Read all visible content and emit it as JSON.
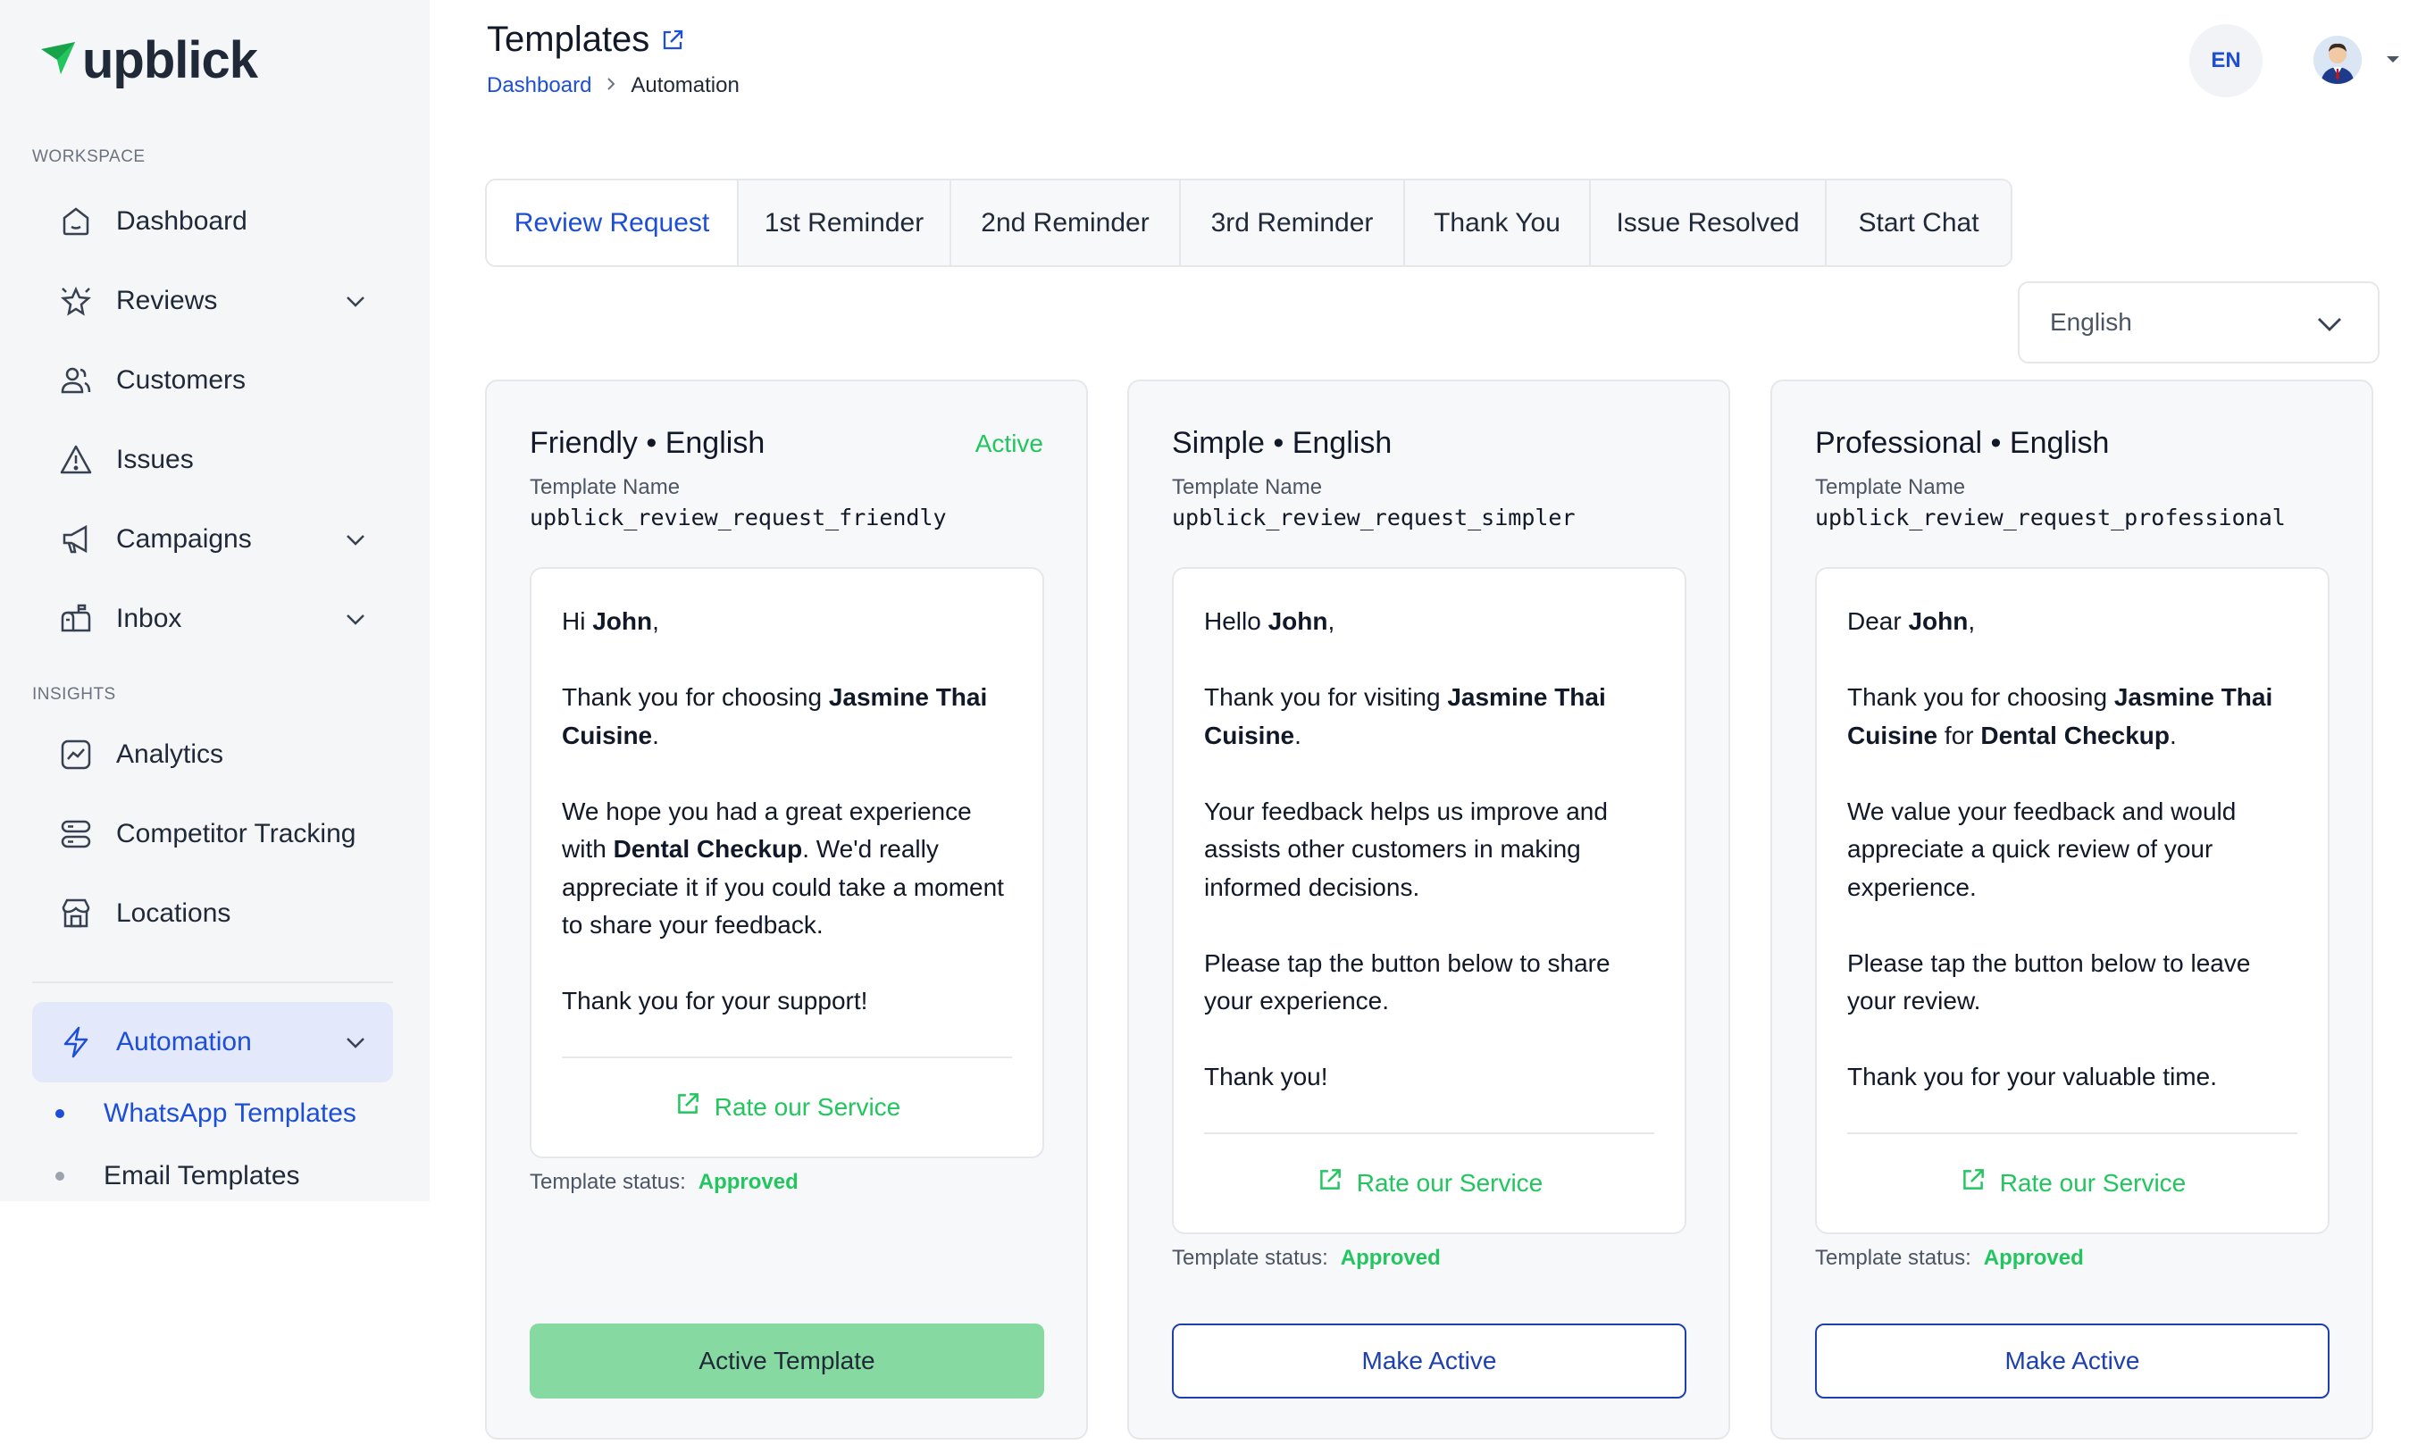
{
  "brand": {
    "name": "upblick"
  },
  "sidebar": {
    "workspace_label": "WORKSPACE",
    "insights_label": "INSIGHTS",
    "items": [
      {
        "label": "Dashboard",
        "icon": "home-icon"
      },
      {
        "label": "Reviews",
        "icon": "star-icon"
      },
      {
        "label": "Customers",
        "icon": "users-icon"
      },
      {
        "label": "Issues",
        "icon": "warning-icon"
      },
      {
        "label": "Campaigns",
        "icon": "megaphone-icon"
      },
      {
        "label": "Inbox",
        "icon": "mailbox-icon"
      },
      {
        "label": "Analytics",
        "icon": "chart-icon"
      },
      {
        "label": "Competitor Tracking",
        "icon": "server-icon"
      },
      {
        "label": "Locations",
        "icon": "store-icon"
      },
      {
        "label": "Automation",
        "icon": "bolt-icon"
      }
    ],
    "sub_items": [
      {
        "label": "WhatsApp Templates"
      },
      {
        "label": "Email Templates"
      }
    ]
  },
  "header": {
    "title": "Templates",
    "breadcrumb": {
      "root": "Dashboard",
      "current": "Automation"
    },
    "language_code": "EN"
  },
  "tabs": [
    {
      "label": "Review Request"
    },
    {
      "label": "1st Reminder"
    },
    {
      "label": "2nd Reminder"
    },
    {
      "label": "3rd Reminder"
    },
    {
      "label": "Thank You"
    },
    {
      "label": "Issue Resolved"
    },
    {
      "label": "Start Chat"
    }
  ],
  "language_select": {
    "value": "English"
  },
  "cards": [
    {
      "title": "Friendly • English",
      "badge": "Active",
      "template_name_label": "Template Name",
      "template_name": "upblick_review_request_friendly",
      "link_label": "Rate our Service",
      "status_label": "Template status:",
      "status_value": "Approved",
      "button_label": "Active Template"
    },
    {
      "title": "Simple • English",
      "template_name_label": "Template Name",
      "template_name": "upblick_review_request_simpler",
      "link_label": "Rate our Service",
      "status_label": "Template status:",
      "status_value": "Approved",
      "button_label": "Make Active"
    },
    {
      "title": "Professional • English",
      "template_name_label": "Template Name",
      "template_name": "upblick_review_request_professional",
      "link_label": "Rate our Service",
      "status_label": "Template status:",
      "status_value": "Approved",
      "button_label": "Make Active"
    }
  ],
  "messages": {
    "friendly": {
      "greet": "Hi ",
      "name": "John",
      "greet_end": ",",
      "p1a": "Thank you for choosing ",
      "business": "Jasmine Thai Cuisine",
      "p1b": ".",
      "p2a": "We hope you had a great experience with ",
      "service": "Dental Checkup",
      "p2b": ". We'd really appreciate it if you could take a moment to share your feedback.",
      "p3": "Thank you for your support!"
    },
    "simple": {
      "greet": "Hello ",
      "name": "John",
      "greet_end": ",",
      "p1a": "Thank you for visiting ",
      "business": "Jasmine Thai Cuisine",
      "p1b": ".",
      "p2": "Your feedback helps us improve and assists other customers in making informed decisions.",
      "p3": "Please tap the button below to share your experience.",
      "p4": "Thank you!"
    },
    "professional": {
      "greet": "Dear ",
      "name": "John",
      "greet_end": ",",
      "p1a": "Thank you for choosing ",
      "business": "Jasmine Thai Cuisine",
      "p1mid": " for ",
      "service": "Dental Checkup",
      "p1b": ".",
      "p2": "We value your feedback and would appreciate a quick review of your experience.",
      "p3": "Please tap the button below to leave your review.",
      "p4": "Thank you for your valuable time."
    }
  },
  "colors": {
    "accent": "#1d4ed8",
    "success": "#22c55e",
    "active_button": "#86d9a0"
  }
}
